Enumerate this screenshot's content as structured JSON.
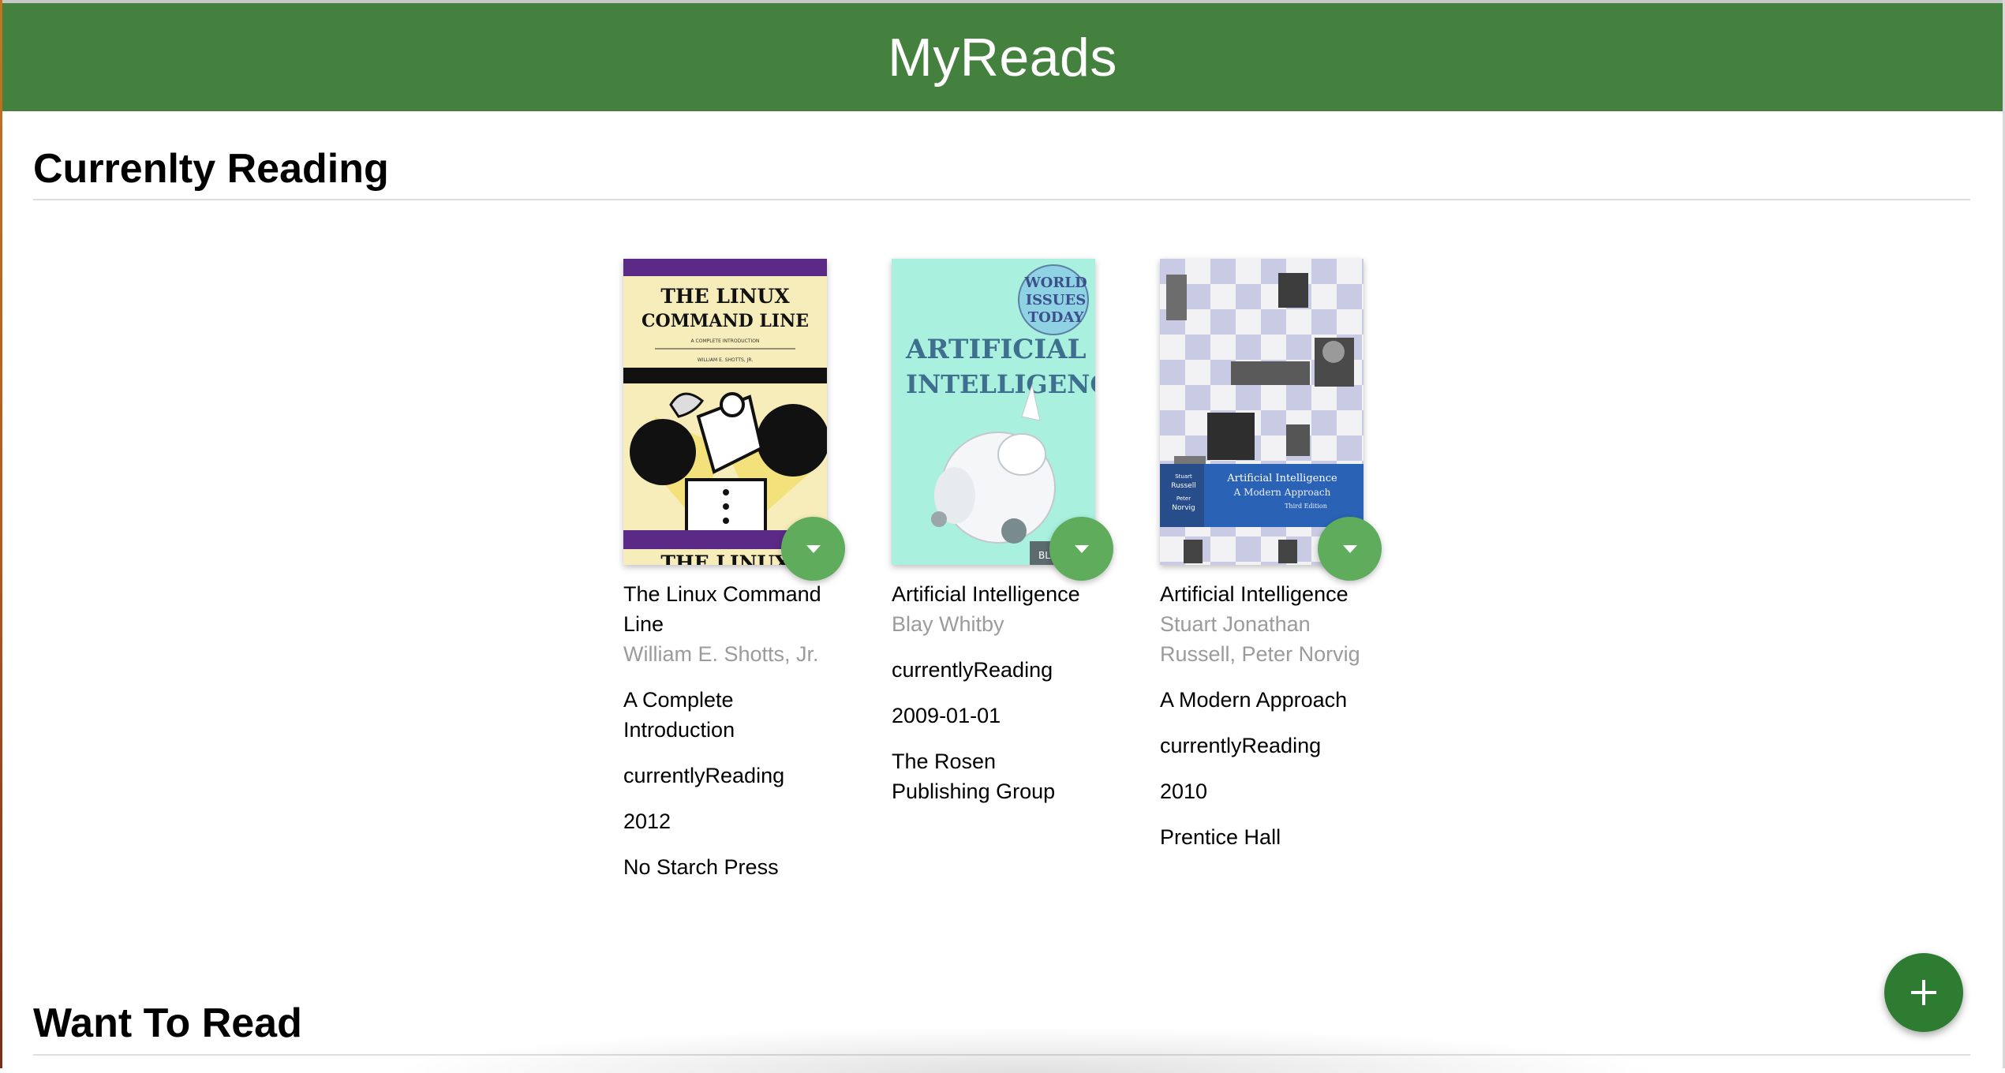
{
  "app": {
    "title": "MyReads"
  },
  "shelves": [
    {
      "title": "Currenlty Reading",
      "books": [
        {
          "title": "The Linux Command Line",
          "authors": "William E. Shotts, Jr.",
          "subtitle": "A Complete Introduction",
          "shelf": "currentlyReading",
          "published": "2012",
          "publisher": "No Starch Press",
          "cover": {
            "heading_line1": "THE LINUX",
            "heading_line2": "COMMAND LINE",
            "tagline": "A COMPLETE INTRODUCTION",
            "author": "WILLIAM E. SHOTTS, JR.",
            "footer": "THE LINUX"
          }
        },
        {
          "title": "Artificial Intelligence",
          "authors": "Blay Whitby",
          "shelf": "currentlyReading",
          "published": "2009-01-01",
          "publisher": "The Rosen Publishing Group",
          "cover": {
            "series_line1": "WORLD",
            "series_line2": "ISSUES",
            "series_line3": "TODAY",
            "heading_line1": "ARTIFICIAL",
            "heading_line2": "INTELLIGENCE",
            "author_stub": "BLA"
          }
        },
        {
          "title": "Artificial Intelligence",
          "authors": "Stuart Jonathan Russell, Peter Norvig",
          "subtitle": "A Modern Approach",
          "shelf": "currentlyReading",
          "published": "2010",
          "publisher": "Prentice Hall",
          "cover": {
            "author1": "Stuart",
            "author1b": "Russell",
            "author2": "Peter",
            "author2b": "Norvig",
            "title_line1": "Artificial Intelligence",
            "title_line2": "A Modern Approach",
            "edition": "Third Edition"
          }
        }
      ]
    },
    {
      "title": "Want To Read"
    }
  ],
  "colors": {
    "header": "#45813e",
    "shelf_changer": "#60ac5d",
    "add_button": "#2e7c31"
  },
  "icons": {
    "shelf_changer": "caret-down-icon",
    "add": "plus-icon"
  }
}
